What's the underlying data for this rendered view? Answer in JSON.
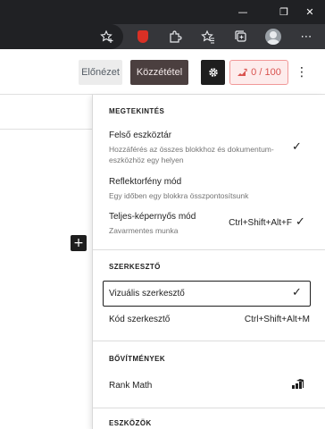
{
  "browser": {
    "window_controls": {
      "minimize": "—",
      "restore": "❐",
      "close": "✕"
    },
    "toolbar_icons": [
      "favorites-add-icon",
      "extension-shield-icon",
      "extensions-puzzle-icon",
      "favorites-icon",
      "collections-icon",
      "profile-avatar-icon",
      "more-icon"
    ]
  },
  "header": {
    "preview_label": "Előnézet",
    "publish_label": "Közzététel",
    "rank_math_score": "0 / 100",
    "colors": {
      "publish_bg": "#4b3f3f",
      "rank_math_bg": "#fdecec",
      "rank_math_text": "#d9534f"
    }
  },
  "menu": {
    "view": {
      "title": "MEGTEKINTÉS",
      "items": [
        {
          "label": "Felső eszköztár",
          "description": "Hozzáférés az összes blokkhoz és dokumentum-eszközhöz egy helyen",
          "checked": true
        },
        {
          "label": "Reflektorfény mód",
          "description": "Egy időben egy blokkra összpontosítsunk",
          "checked": false
        },
        {
          "label": "Teljes-képernyős mód",
          "description": "Zavarmentes munka",
          "shortcut": "Ctrl+Shift+Alt+F",
          "checked": true
        }
      ]
    },
    "editor": {
      "title": "SZERKESZTŐ",
      "items": [
        {
          "label": "Vizuális szerkesztő",
          "checked": true,
          "selected": true
        },
        {
          "label": "Kód szerkesztő",
          "shortcut": "Ctrl+Shift+Alt+M"
        }
      ]
    },
    "plugins": {
      "title": "BŐVÍTMÉNYEK",
      "items": [
        {
          "label": "Rank Math",
          "icon": "rank-math-icon"
        }
      ]
    },
    "tools": {
      "title": "ESZKÖZÖK"
    }
  },
  "canvas": {
    "inserter_icon": "plus-icon"
  }
}
